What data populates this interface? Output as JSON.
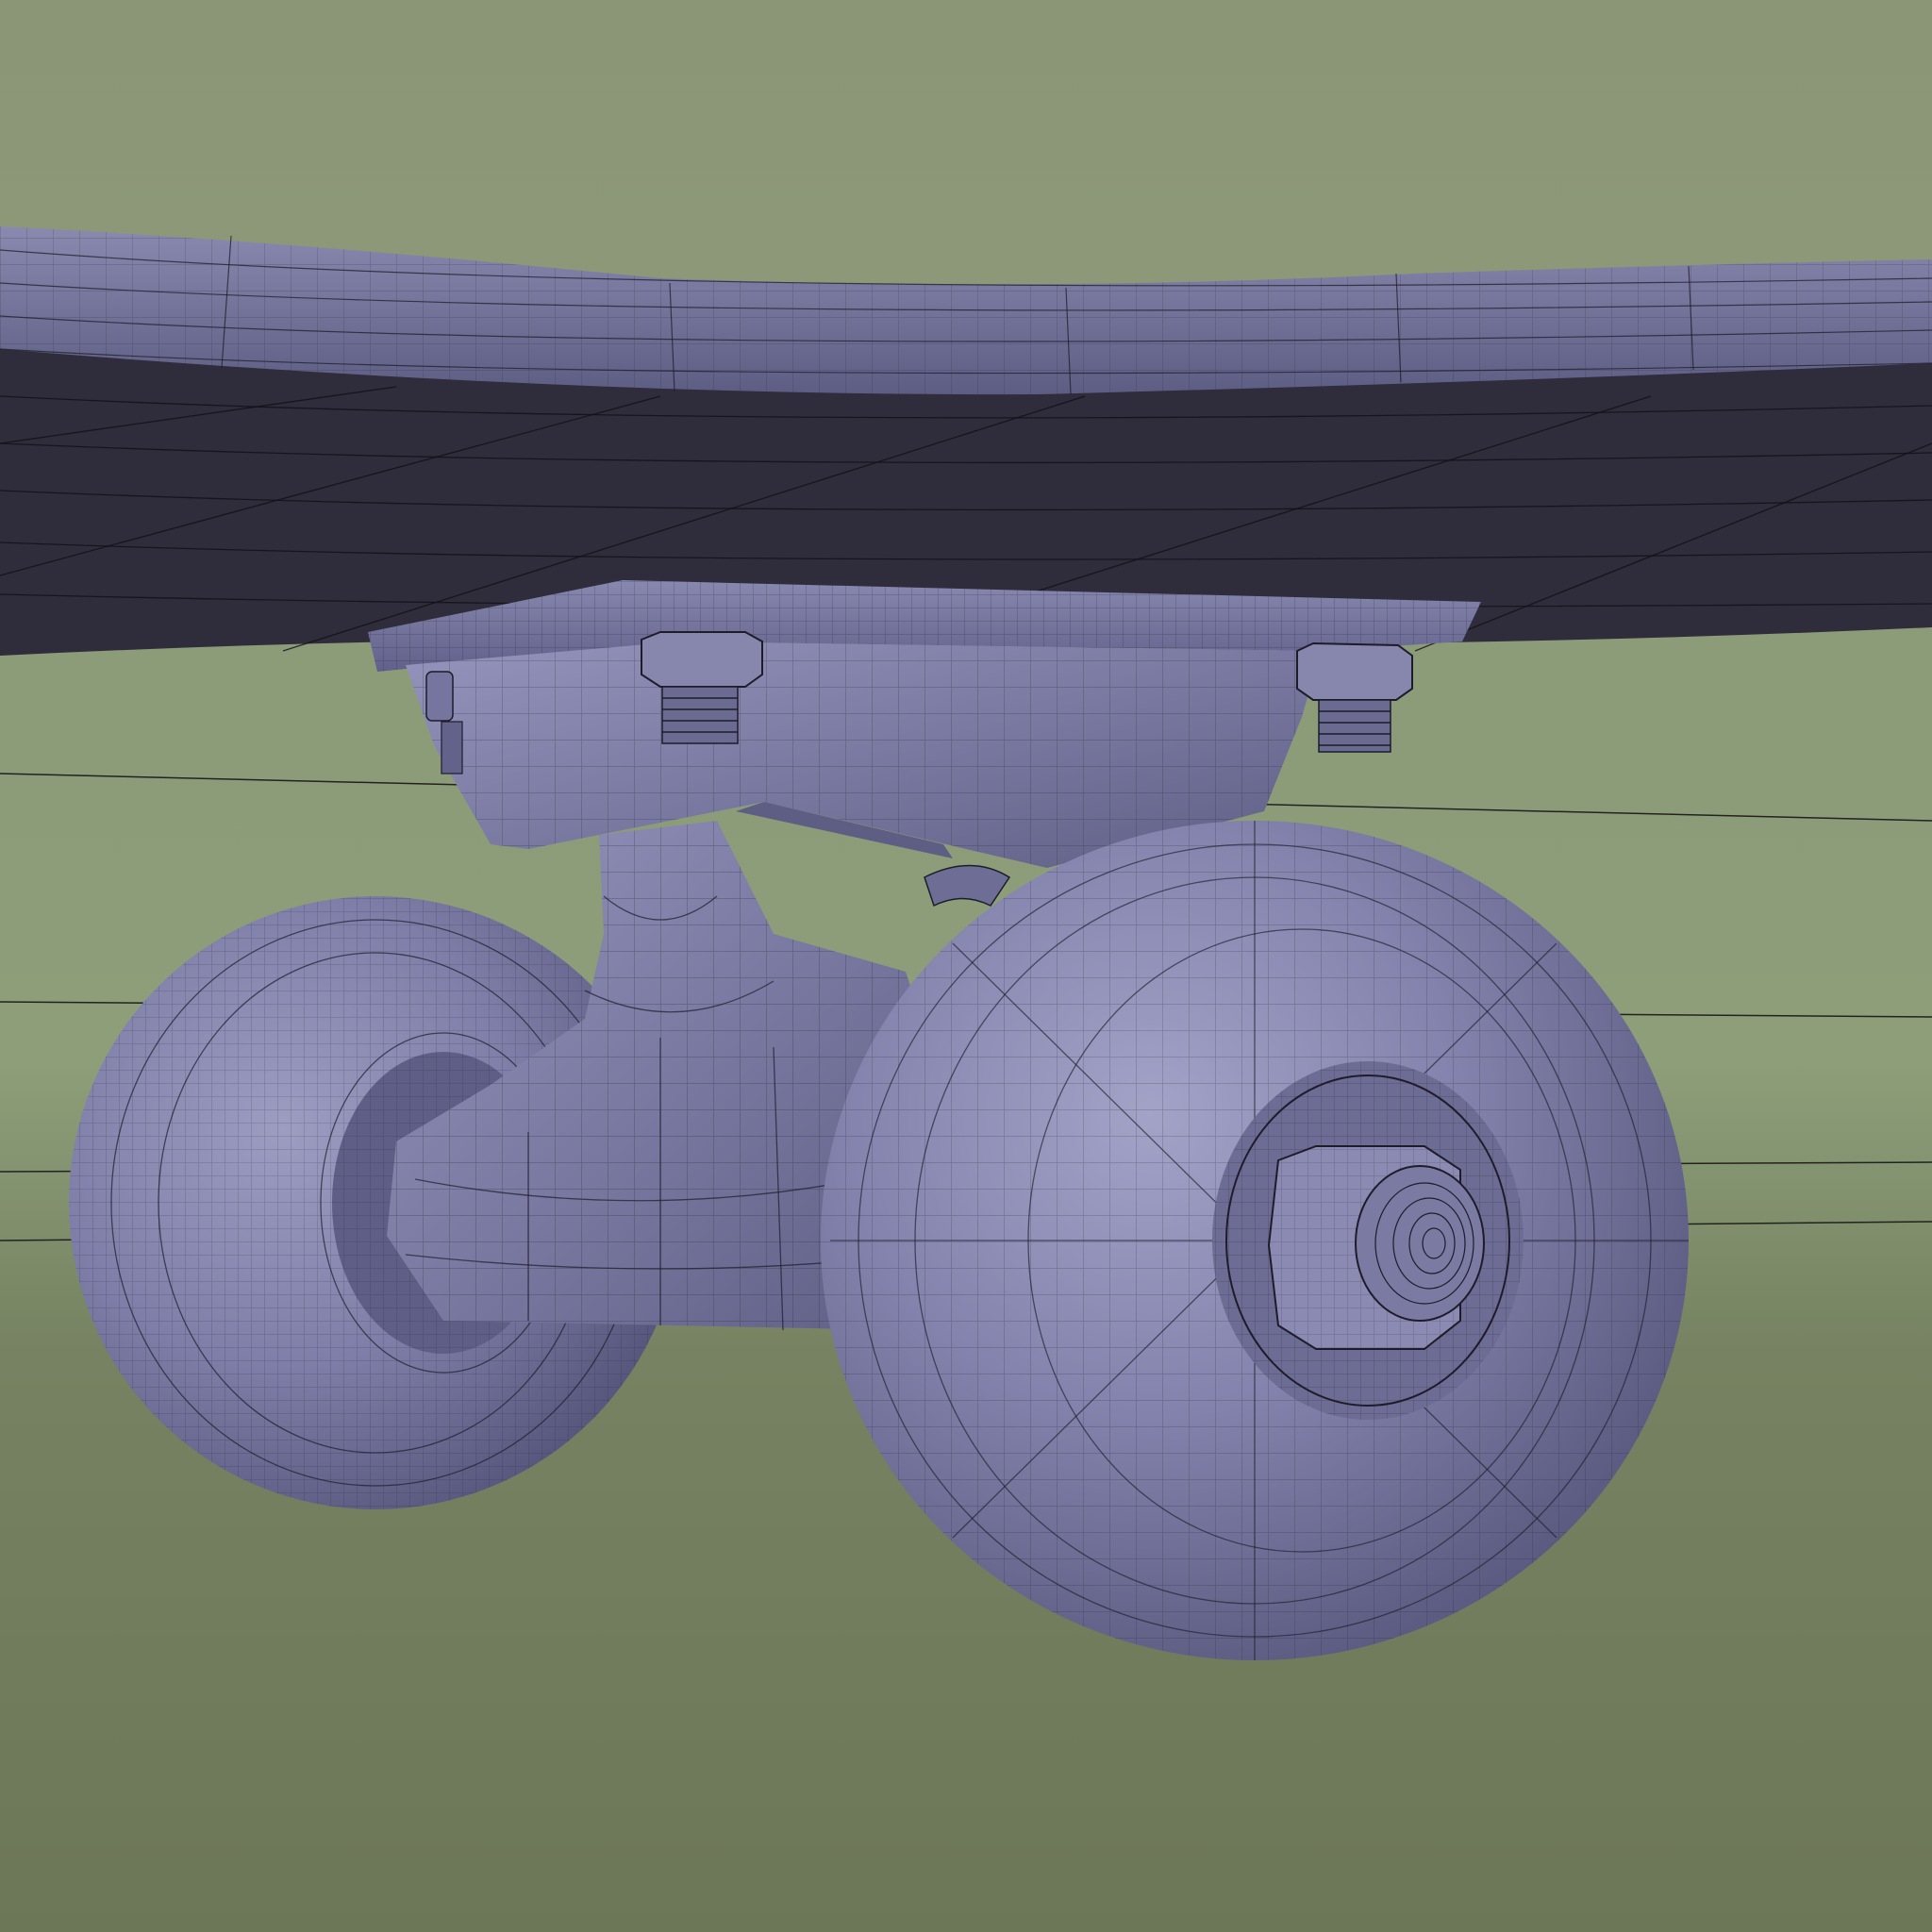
{
  "scene": {
    "subject": "skateboard-truck-wireframe-render",
    "colors": {
      "background_top": "#8c977a",
      "background_mid": "#8fa07a",
      "background_bottom": "#6f7a5a",
      "model_base": "#7f7fa8",
      "model_highlight": "#9c9cc4",
      "model_shadow": "#55557a",
      "deck_underside": "#2f2c3b",
      "wire": "#1d1d2a"
    },
    "objects": [
      "deck",
      "baseplate",
      "kingpin-hanger",
      "left-wheel",
      "right-wheel",
      "axle-nut",
      "mounting-bolts"
    ]
  }
}
